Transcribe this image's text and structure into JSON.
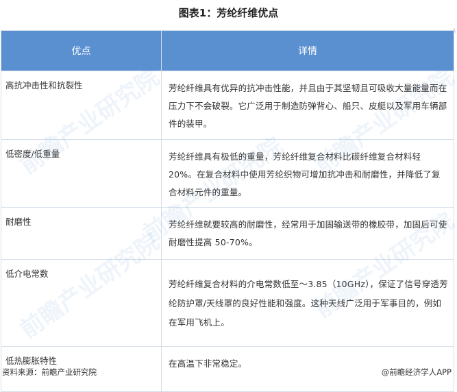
{
  "title": "图表1：芳纶纤维优点",
  "corner_mark": "\\",
  "table": {
    "headers": [
      "优点",
      "详情"
    ],
    "rows": [
      {
        "feature": "高抗冲击性和抗裂性",
        "detail": "芳纶纤维具有优异的抗冲击性能，并且由于其坚韧且可吸收大量能量而在压力下不会破裂。它广泛用于制造防弹背心、船只、皮艇以及军用车辆部件的装甲。"
      },
      {
        "feature": "低密度/低重量",
        "detail": "芳纶纤维具有极低的重量，芳纶纤维复合材料比碳纤维复合材料轻20%。在复合材料中使用芳纶织物可增加抗冲击和耐磨性，并降低了复合材料元件的重量。"
      },
      {
        "feature": "耐磨性",
        "detail": "芳纶纤维就要较高的耐磨性，经常用于加固输送带的橡胶带，加固后可使耐磨性提高 50-70%。"
      },
      {
        "feature": "低介电常数",
        "detail": "芳纶纤维复合材料的介电常数低至～3.85（10GHz），保证了信号穿透芳纶防护罩/天线罩的良好性能和强度。这种天线广泛用于军事目的，例如在军用飞机上。"
      },
      {
        "feature": "低热膨胀特性",
        "detail": "在高温下非常稳定。"
      }
    ]
  },
  "footer": {
    "source": "资料来源：前瞻产业研究院",
    "brand": "@前瞻经济学人APP"
  },
  "watermark_text": "前瞻产业研究院"
}
